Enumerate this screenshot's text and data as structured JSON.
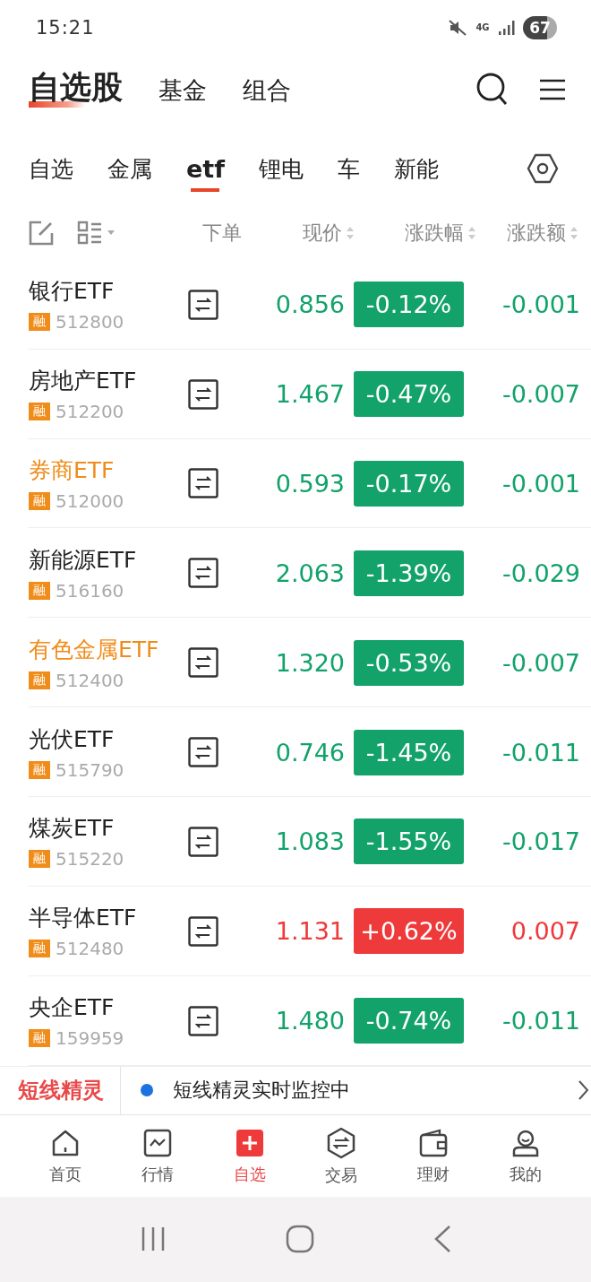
{
  "status_bar": {
    "time": "15:21",
    "network": "4G",
    "battery": "67"
  },
  "header": {
    "tabs": [
      {
        "label": "自选股",
        "selected": true
      },
      {
        "label": "基金",
        "selected": false
      },
      {
        "label": "组合",
        "selected": false
      }
    ]
  },
  "groups": [
    {
      "label": "自选",
      "selected": false
    },
    {
      "label": "金属",
      "selected": false
    },
    {
      "label": "etf",
      "selected": true
    },
    {
      "label": "锂电",
      "selected": false
    },
    {
      "label": "车",
      "selected": false
    },
    {
      "label": "新能",
      "selected": false
    }
  ],
  "columns": [
    "下单",
    "现价",
    "涨跌幅",
    "涨跌额"
  ],
  "rows": [
    {
      "name": "银行ETF",
      "highlighted": false,
      "tag": "融",
      "code": "512800",
      "price": "0.856",
      "change_pct": "-0.12%",
      "change": "-0.001",
      "kind": "loss"
    },
    {
      "name": "房地产ETF",
      "highlighted": false,
      "tag": "融",
      "code": "512200",
      "price": "1.467",
      "change_pct": "-0.47%",
      "change": "-0.007",
      "kind": "loss"
    },
    {
      "name": "券商ETF",
      "highlighted": true,
      "tag": "融",
      "code": "512000",
      "price": "0.593",
      "change_pct": "-0.17%",
      "change": "-0.001",
      "kind": "loss"
    },
    {
      "name": "新能源ETF",
      "highlighted": false,
      "tag": "融",
      "code": "516160",
      "price": "2.063",
      "change_pct": "-1.39%",
      "change": "-0.029",
      "kind": "loss"
    },
    {
      "name": "有色金属ETF",
      "highlighted": true,
      "tag": "融",
      "code": "512400",
      "price": "1.320",
      "change_pct": "-0.53%",
      "change": "-0.007",
      "kind": "loss"
    },
    {
      "name": "光伏ETF",
      "highlighted": false,
      "tag": "融",
      "code": "515790",
      "price": "0.746",
      "change_pct": "-1.45%",
      "change": "-0.011",
      "kind": "loss"
    },
    {
      "name": "煤炭ETF",
      "highlighted": false,
      "tag": "融",
      "code": "515220",
      "price": "1.083",
      "change_pct": "-1.55%",
      "change": "-0.017",
      "kind": "loss"
    },
    {
      "name": "半导体ETF",
      "highlighted": false,
      "tag": "融",
      "code": "512480",
      "price": "1.131",
      "change_pct": "+0.62%",
      "change": "0.007",
      "kind": "gain"
    },
    {
      "name": "央企ETF",
      "highlighted": false,
      "tag": "融",
      "code": "159959",
      "price": "1.480",
      "change_pct": "-0.74%",
      "change": "-0.011",
      "kind": "loss"
    }
  ],
  "banner": {
    "title": "短线精灵",
    "message": "短线精灵实时监控中"
  },
  "bottom_nav": [
    {
      "label": "首页",
      "selected": false
    },
    {
      "label": "行情",
      "selected": false
    },
    {
      "label": "自选",
      "selected": true
    },
    {
      "label": "交易",
      "selected": false
    },
    {
      "label": "理财",
      "selected": false
    },
    {
      "label": "我的",
      "selected": false
    }
  ]
}
